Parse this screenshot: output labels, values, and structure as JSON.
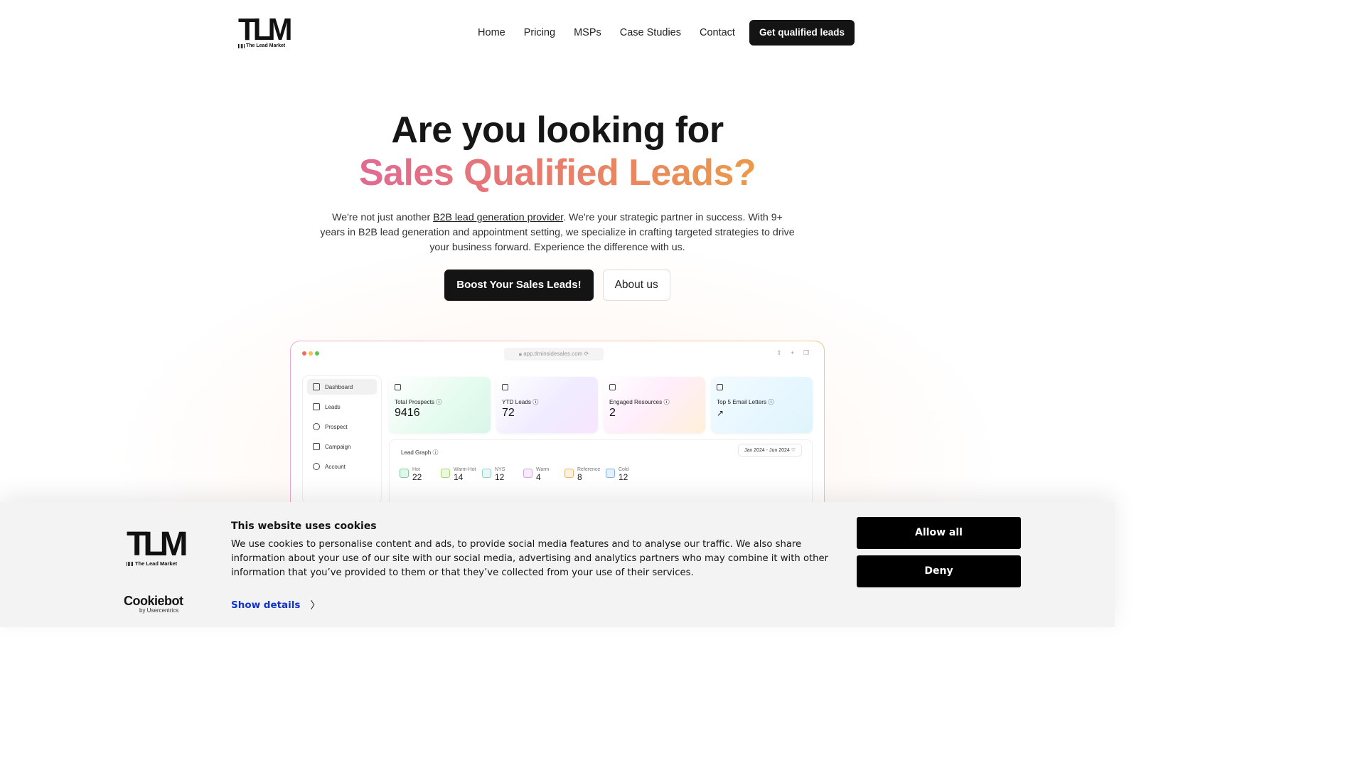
{
  "header": {
    "logo_mark": "TLM",
    "logo_tagline": "The Lead Market",
    "nav": [
      "Home",
      "Pricing",
      "MSPs",
      "Case Studies",
      "Contact"
    ],
    "cta": "Get qualified leads"
  },
  "hero": {
    "title_line1": "Are you looking for",
    "title_line2": "Sales Qualified Leads?",
    "lead_before": "We're not just another ",
    "lead_link": "B2B lead generation provider",
    "lead_after": ". We're your strategic partner in success. With 9+ years in B2B lead generation and appointment setting, we specialize in crafting targeted strategies to drive your business forward. Experience the difference with us.",
    "primary_button": "Boost Your Sales Leads!",
    "secondary_button": "About us",
    "gradient_colors": [
      "#e06a93",
      "#e87a6e",
      "#ea9a4a"
    ]
  },
  "dashboard": {
    "url": "app.tlminsidesales.com",
    "sidebar": [
      "Dashboard",
      "Leads",
      "Prospect",
      "Campaign",
      "Account"
    ],
    "cards": [
      {
        "label": "Total Prospects",
        "value": "9416"
      },
      {
        "label": "YTD Leads",
        "value": "72"
      },
      {
        "label": "Engaged Resources",
        "value": "2"
      },
      {
        "label": "Top 5 Email Letters",
        "value": "↗"
      }
    ],
    "graph_title": "Lead Graph",
    "graph_range": "Jan 2024 - Jun 2024",
    "stats": [
      {
        "label": "Hot",
        "value": "22",
        "color": "#7ccfa0"
      },
      {
        "label": "Warm-Hot",
        "value": "14",
        "color": "#a8d86a"
      },
      {
        "label": "NYS",
        "value": "12",
        "color": "#8fd3c8"
      },
      {
        "label": "Warm",
        "value": "4",
        "color": "#d3a6e6"
      },
      {
        "label": "Reference",
        "value": "8",
        "color": "#f0b76a"
      },
      {
        "label": "Cold",
        "value": "12",
        "color": "#7fb3e8"
      }
    ]
  },
  "cookie_banner": {
    "logo_mark": "TLM",
    "logo_tagline": "The Lead Market",
    "title": "This website uses cookies",
    "text": "We use cookies to personalise content and ads, to provide social media features and to analyse our traffic. We also share information about your use of our site with our social media, advertising and analytics partners who may combine it with other information that you’ve provided to them or that they’ve collected from your use of their services.",
    "details_link": "Show details",
    "allow_button": "Allow all",
    "deny_button": "Deny",
    "brand": "Cookiebot",
    "brand_sub": "by Usercentrics"
  }
}
